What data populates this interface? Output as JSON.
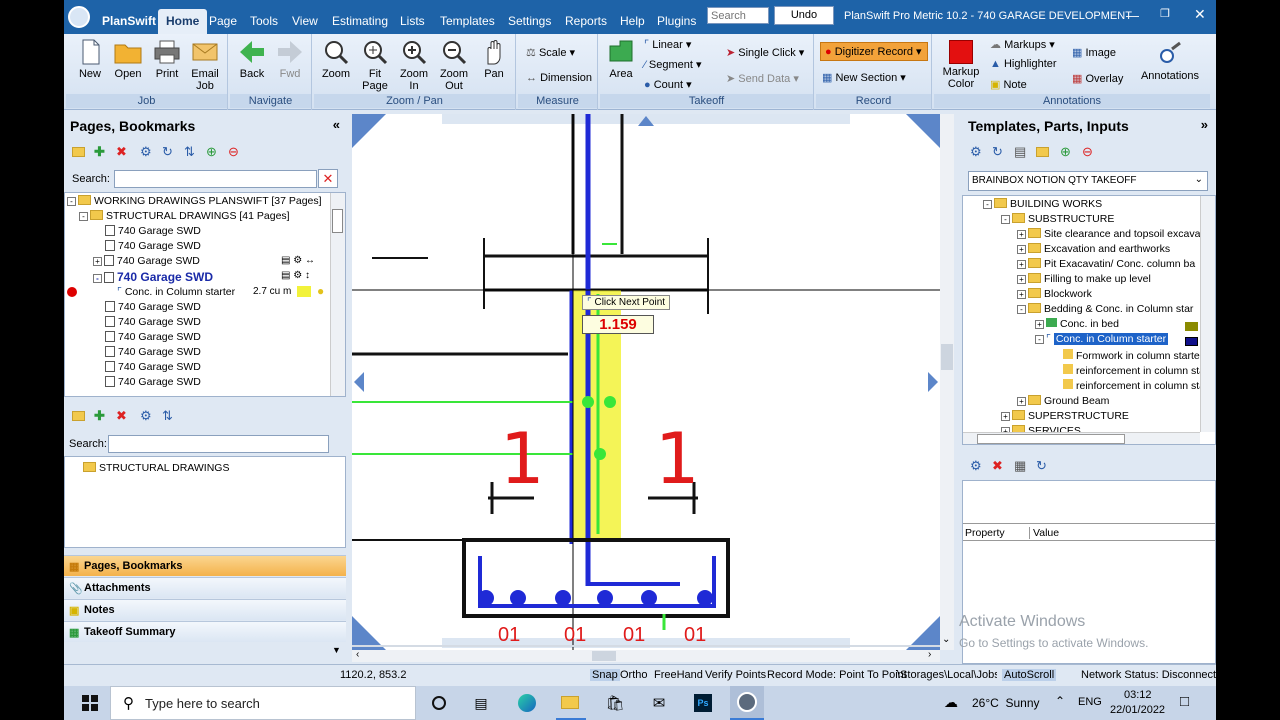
{
  "app": {
    "title": "PlanSwift Pro Metric 10.2 - 740 GARAGE DEVELOPMENT",
    "brand": "PlanSwift",
    "menus": [
      "Home",
      "Page",
      "Tools",
      "View",
      "Estimating",
      "Lists",
      "Templates",
      "Settings",
      "Reports",
      "Help",
      "Plugins"
    ],
    "search_placeholder": "Search",
    "undo_label": "Undo"
  },
  "ribbon": {
    "job": {
      "caption": "Job",
      "new": "New",
      "open": "Open",
      "print": "Print",
      "email": "Email Job"
    },
    "navigate": {
      "caption": "Navigate",
      "back": "Back",
      "fwd": "Fwd"
    },
    "zoom": {
      "caption": "Zoom / Pan",
      "zoom": "Zoom",
      "fit": "Fit Page",
      "zin": "Zoom In",
      "zout": "Zoom Out",
      "pan": "Pan"
    },
    "measure": {
      "caption": "Measure",
      "scale": "Scale",
      "dimension": "Dimension"
    },
    "takeoff": {
      "caption": "Takeoff",
      "area": "Area",
      "linear": "Linear",
      "segment": "Segment",
      "count": "Count",
      "single_click": "Single Click",
      "send_data": "Send Data"
    },
    "record": {
      "caption": "Record",
      "digitizer": "Digitizer Record",
      "new_section": "New Section"
    },
    "annotations": {
      "caption": "Annotations",
      "markup_color": "Markup Color",
      "markups": "Markups",
      "highlighter": "Highlighter",
      "note": "Note",
      "image": "Image",
      "overlay": "Overlay",
      "annotations": "Annotations"
    }
  },
  "left": {
    "title": "Pages, Bookmarks",
    "search_label": "Search:",
    "tree": [
      {
        "label": "WORKING DRAWINGS PLANSWIFT [37 Pages]"
      },
      {
        "label": "STRUCTURAL DRAWINGS [41 Pages]"
      },
      {
        "label": "740 Garage SWD"
      },
      {
        "label": "740 Garage SWD"
      },
      {
        "label": "740 Garage SWD"
      },
      {
        "label": "740 Garage SWD"
      },
      {
        "label": "Conc. in Column starter",
        "qty": "2.7 cu m"
      },
      {
        "label": "740 Garage SWD"
      },
      {
        "label": "740 Garage SWD"
      },
      {
        "label": "740 Garage SWD"
      },
      {
        "label": "740 Garage SWD"
      },
      {
        "label": "740 Garage SWD"
      },
      {
        "label": "740 Garage SWD"
      }
    ],
    "search2_label": "Search:",
    "folder2": "STRUCTURAL DRAWINGS",
    "tabs": [
      "Pages, Bookmarks",
      "Attachments",
      "Notes",
      "Takeoff Summary"
    ]
  },
  "canvas": {
    "tooltip": "Click Next Point",
    "measure_value": "1.159",
    "labels": {
      "one_a": "1",
      "one_b": "1",
      "d1": "01",
      "d2": "01",
      "d3": "01",
      "d4": "01"
    }
  },
  "right": {
    "title": "Templates, Parts, Inputs",
    "dropdown": "BRAINBOX NOTION QTY TAKEOFF",
    "tree": [
      "BUILDING WORKS",
      "SUBSTRUCTURE",
      "Site clearance and topsoil excava",
      "Excavation and earthworks",
      "Pit Exacavatin/ Conc. column ba",
      "Filling to make up level",
      "Blockwork",
      "Bedding & Conc. in Column star",
      "Conc. in bed",
      "Conc. in Column starter",
      "Formwork in column starter",
      "reinforcement in column sta",
      "reinforcement in column sta",
      "Ground Beam",
      "SUPERSTRUCTURE",
      "SERVICES"
    ],
    "prop_header": "Property",
    "value_header": "Value",
    "watermark1": "Activate Windows",
    "watermark2": "Go to Settings to activate Windows."
  },
  "status": {
    "coords": "1120.2, 853.2",
    "snap": "Snap",
    "ortho": "Ortho",
    "freehand": "FreeHand",
    "verify": "Verify Points",
    "record_mode": "Record Mode: Point To Point",
    "storage": "\\Storages\\Local\\Jobs\\",
    "autoscroll": "AutoScroll",
    "network": "Network Status: Disconnected"
  },
  "taskbar": {
    "search": "Type here to search",
    "weather": "26°C  Sunny",
    "lang": "ENG",
    "time": "03:12",
    "date": "22/01/2022"
  },
  "colors": {
    "accent": "#1e63a8",
    "ribbon": "#dfe8f3",
    "highlight": "#f2f23a",
    "blue_line": "#1f2ad6",
    "green": "#39e639",
    "red": "#e01b1b"
  }
}
